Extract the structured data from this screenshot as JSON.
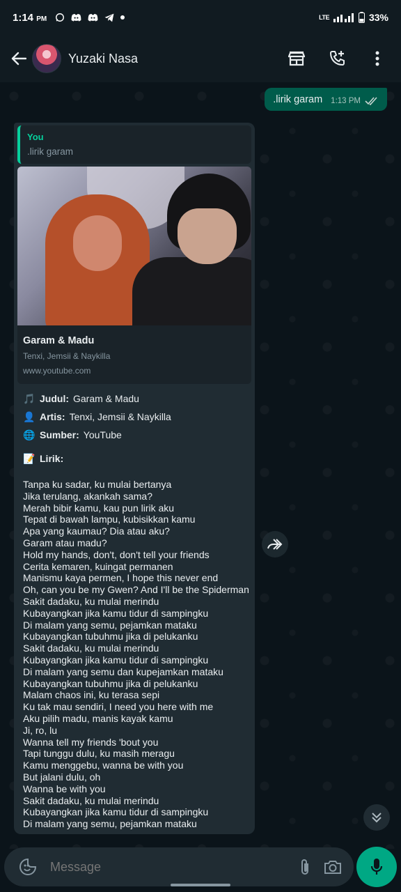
{
  "status_bar": {
    "time": "1:14",
    "ampm": "PM",
    "network": "LTE",
    "battery": "33%",
    "notification_icons": [
      "whatsapp-icon",
      "discord-icon",
      "discord-icon",
      "telegram-icon",
      "dot-icon"
    ]
  },
  "header": {
    "contact_name": "Yuzaki Nasa",
    "actions": [
      "shop-icon",
      "add-call-icon",
      "more-vert-icon"
    ]
  },
  "outgoing_message": {
    "text": ".lirik garam",
    "time": "1:13 PM",
    "status": "read"
  },
  "incoming_message": {
    "quote": {
      "author": "You",
      "text": ".lirik garam"
    },
    "link_preview": {
      "title": "Garam & Madu",
      "subtitle": "Tenxi, Jemsii & Naykilla",
      "domain": "www.youtube.com"
    },
    "info": [
      {
        "emoji": "🎵",
        "label": "Judul:",
        "value": "Garam & Madu"
      },
      {
        "emoji": "👤",
        "label": "Artis:",
        "value": "Tenxi, Jemsii & Naykilla"
      },
      {
        "emoji": "🌐",
        "label": "Sumber:",
        "value": "YouTube"
      }
    ],
    "lyrics_heading": {
      "emoji": "📝",
      "label": "Lirik:"
    },
    "lyrics": [
      "Tanpa ku sadar, ku mulai bertanya",
      "Jika terulang, akankah sama?",
      "Merah bibir kamu, kau pun lirik aku",
      "Tepat di bawah lampu, kubisikkan kamu",
      "Apa yang kaumau? Dia atau aku?",
      "Garam atau madu?",
      "Hold my hands, don't, don't tell your friends",
      "Cerita kemaren, kuingat permanen",
      "Manismu kaya permen, I hope this never end",
      "Oh, can you be my Gwen? And I'll be the Spiderman",
      "Sakit dadaku, ku mulai merindu",
      "Kubayangkan jika kamu tidur di sampingku",
      "Di malam yang semu, pejamkan mataku",
      "Kubayangkan tubuhmu jika di pelukanku",
      "Sakit dadaku, ku mulai merindu",
      "Kubayangkan jika kamu tidur di sampingku",
      "Di malam yang semu dan kupejamkan mataku",
      "Kubayangkan tubuhmu jika di pelukanku",
      "Malam chaos ini, ku terasa sepi",
      "Ku tak mau sendiri, I need you here with me",
      "Aku pilih madu, manis kayak kamu",
      "Ji, ro, lu",
      "Wanna tell my friends 'bout you",
      "Tapi tunggu dulu, ku masih meragu",
      "Kamu menggebu, wanna be with you",
      "But jalani dulu, oh",
      "Wanna be with you",
      "Sakit dadaku, ku mulai merindu",
      "Kubayangkan jika kamu tidur di sampingku",
      "Di malam yang semu, pejamkan mataku"
    ]
  },
  "composer": {
    "placeholder": "Message"
  },
  "colors": {
    "accent": "#00a884",
    "outgoing_bubble": "#005c4b",
    "incoming_bubble": "#202c33",
    "quote_accent": "#06cf9c",
    "background": "#0b141a"
  }
}
